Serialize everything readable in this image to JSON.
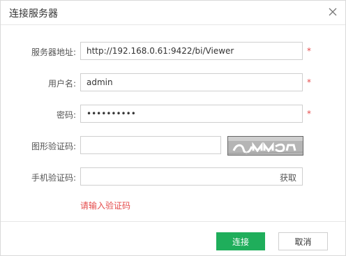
{
  "dialog": {
    "title": "连接服务器",
    "close_icon": "close-icon"
  },
  "fields": {
    "server": {
      "label": "服务器地址:",
      "value": "http://192.168.0.61:9422/bi/Viewer",
      "required_mark": "*"
    },
    "username": {
      "label": "用户名:",
      "value": "admin",
      "required_mark": "*"
    },
    "password": {
      "label": "密码:",
      "value": "••••••••••",
      "required_mark": "*"
    },
    "captcha": {
      "label": "图形验证码:",
      "value": "",
      "image_icon": "captcha-image"
    },
    "sms_code": {
      "label": "手机验证码:",
      "value": "",
      "action": "获取"
    }
  },
  "error_message": "请输入验证码",
  "buttons": {
    "connect": "连接",
    "cancel": "取消"
  },
  "colors": {
    "primary": "#1fae5b",
    "error": "#e54b4b"
  }
}
